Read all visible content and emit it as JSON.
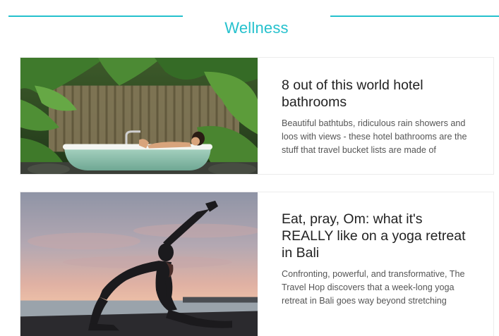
{
  "section": {
    "title": "Wellness",
    "accent_color": "#25c1cd"
  },
  "articles": [
    {
      "title": "8 out of this world hotel bathrooms",
      "description": "Beautiful bathtubs, ridiculous rain showers and loos with views - these hotel bathrooms are the stuff that travel bucket lists are made of",
      "image": "outdoor-bathtub-jungle-photo"
    },
    {
      "title": "Eat, pray, Om: what it's REALLY like on a yoga retreat in Bali",
      "description": "Confronting, powerful, and transformative, The Travel Hop discovers that a week-long yoga retreat in Bali goes way beyond stretching",
      "image": "yoga-silhouette-sunset-photo"
    }
  ]
}
